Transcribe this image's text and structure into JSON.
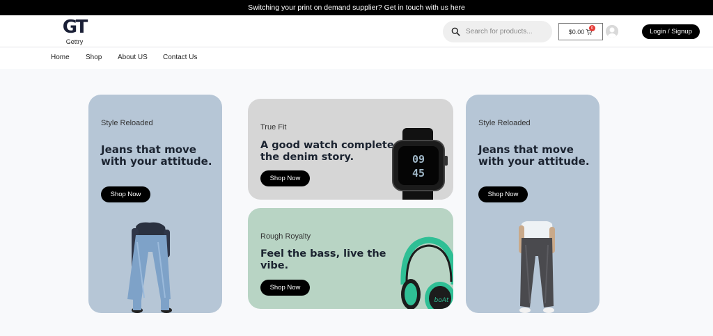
{
  "announcement": "Switching your print on demand supplier? Get in touch with us here",
  "brand": {
    "mark": "GT",
    "name": "Gettry"
  },
  "search": {
    "placeholder": "Search for products..."
  },
  "cart": {
    "total": "$0.00",
    "count": "0"
  },
  "account": {
    "login_label": "Login / Signup"
  },
  "nav": {
    "items": [
      "Home",
      "Shop",
      "About US",
      "Contact Us"
    ]
  },
  "promos": {
    "left": {
      "eyebrow": "Style Reloaded",
      "headline": "Jeans that move with your attitude.",
      "cta": "Shop Now",
      "bg": "#b6c6d6"
    },
    "watch": {
      "eyebrow": "True Fit",
      "headline": "A good watch completes the denim story.",
      "cta": "Shop Now",
      "bg": "#d6d6d6",
      "watch_time": "09 45"
    },
    "headphones": {
      "eyebrow": "Rough Royalty",
      "headline": "Feel the bass, live the vibe.",
      "cta": "Shop Now",
      "bg": "#b8d4c4",
      "product_brand": "boAt"
    },
    "right": {
      "eyebrow": "Style Reloaded",
      "headline": "Jeans that move with your attitude.",
      "cta": "Shop Now",
      "bg": "#b6c6d6"
    }
  },
  "icons": {
    "search": "search-icon",
    "cart": "cart-icon",
    "avatar": "user-avatar-icon"
  }
}
